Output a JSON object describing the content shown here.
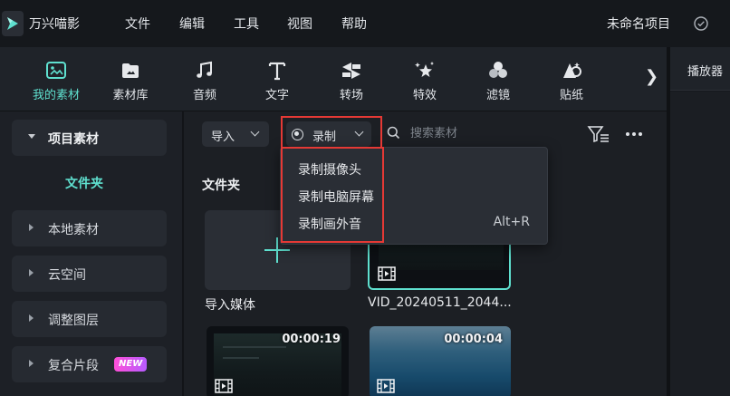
{
  "app": {
    "name": "万兴喵影",
    "project_name": "未命名项目"
  },
  "menu": [
    "文件",
    "编辑",
    "工具",
    "视图",
    "帮助"
  ],
  "toolbar": {
    "items": [
      {
        "label": "我的素材",
        "icon": "my-media-icon",
        "active": true
      },
      {
        "label": "素材库",
        "icon": "stock-media-icon",
        "active": false
      },
      {
        "label": "音频",
        "icon": "music-note-icon",
        "active": false
      },
      {
        "label": "文字",
        "icon": "text-icon",
        "active": false
      },
      {
        "label": "转场",
        "icon": "transition-icon",
        "active": false
      },
      {
        "label": "特效",
        "icon": "effects-icon",
        "active": false
      },
      {
        "label": "滤镜",
        "icon": "filter-icon",
        "active": false
      },
      {
        "label": "贴纸",
        "icon": "sticker-icon",
        "active": false
      }
    ],
    "next_glyph": "❯",
    "accent_color": "#5fe0cf"
  },
  "player": {
    "label": "播放器"
  },
  "sidebar": {
    "items": [
      {
        "label": "项目素材",
        "expanded": true
      },
      {
        "label": "本地素材",
        "expanded": false
      },
      {
        "label": "云空间",
        "expanded": false
      },
      {
        "label": "调整图层",
        "expanded": false
      },
      {
        "label": "复合片段",
        "expanded": false,
        "badge": "NEW"
      }
    ],
    "sub_item": "文件夹"
  },
  "media": {
    "import_label": "导入",
    "record_label": "录制",
    "search_placeholder": "搜索素材",
    "section_title": "文件夹",
    "import_tile_label": "导入媒体",
    "clips": [
      {
        "name": "VID_20240511_2044...",
        "duration": "",
        "selected": true
      },
      {
        "name": "",
        "duration": "00:00:19",
        "selected": false
      },
      {
        "name": "",
        "duration": "00:00:04",
        "selected": false
      }
    ]
  },
  "record_menu": {
    "items": [
      {
        "label": "录制摄像头",
        "shortcut": ""
      },
      {
        "label": "录制电脑屏幕",
        "shortcut": ""
      },
      {
        "label": "录制画外音",
        "shortcut": "Alt+R"
      }
    ]
  },
  "highlight_color": "#e53935"
}
